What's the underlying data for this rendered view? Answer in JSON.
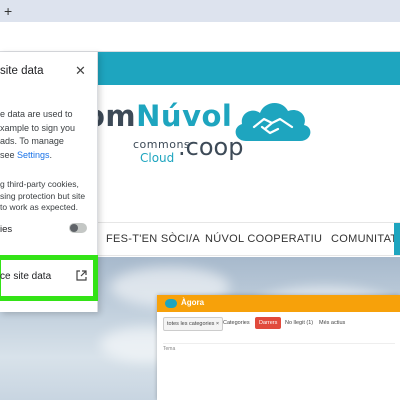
{
  "browser": {
    "new_tab_glyph": "+"
  },
  "site": {
    "logo": {
      "part_a": "om",
      "part_b": "Núvol",
      "commons": "commons",
      "cloud": "Cloud",
      "domain": ".coop"
    },
    "nav": [
      "FES-T'EN SÒCI/A",
      "NÚVOL COOPERATIU",
      "COMUNITAT"
    ],
    "agora": {
      "title": "Àgora",
      "filters": [
        "totes les categories ×",
        "Categories",
        "Darrers",
        "No llegit (1)",
        "Més actius"
      ],
      "row_label": "Tema"
    },
    "colors": {
      "brand": "#1ea5bf",
      "agora_header": "#f7a10a",
      "highlight": "#33e316"
    }
  },
  "panel": {
    "title": "site data",
    "desc_line1": "e data are used to",
    "desc_line2": "xample to sign you",
    "desc_line3": "ads. To manage",
    "desc_line4_prefix": "see ",
    "desc_link": "Settings",
    "desc_line4_suffix": ".",
    "note_line1": "g third-party cookies,",
    "note_line2": "sing protection but site",
    "note_line3": "to work as expected.",
    "toggle_label": "ies",
    "highlight_row": "ce site data"
  }
}
